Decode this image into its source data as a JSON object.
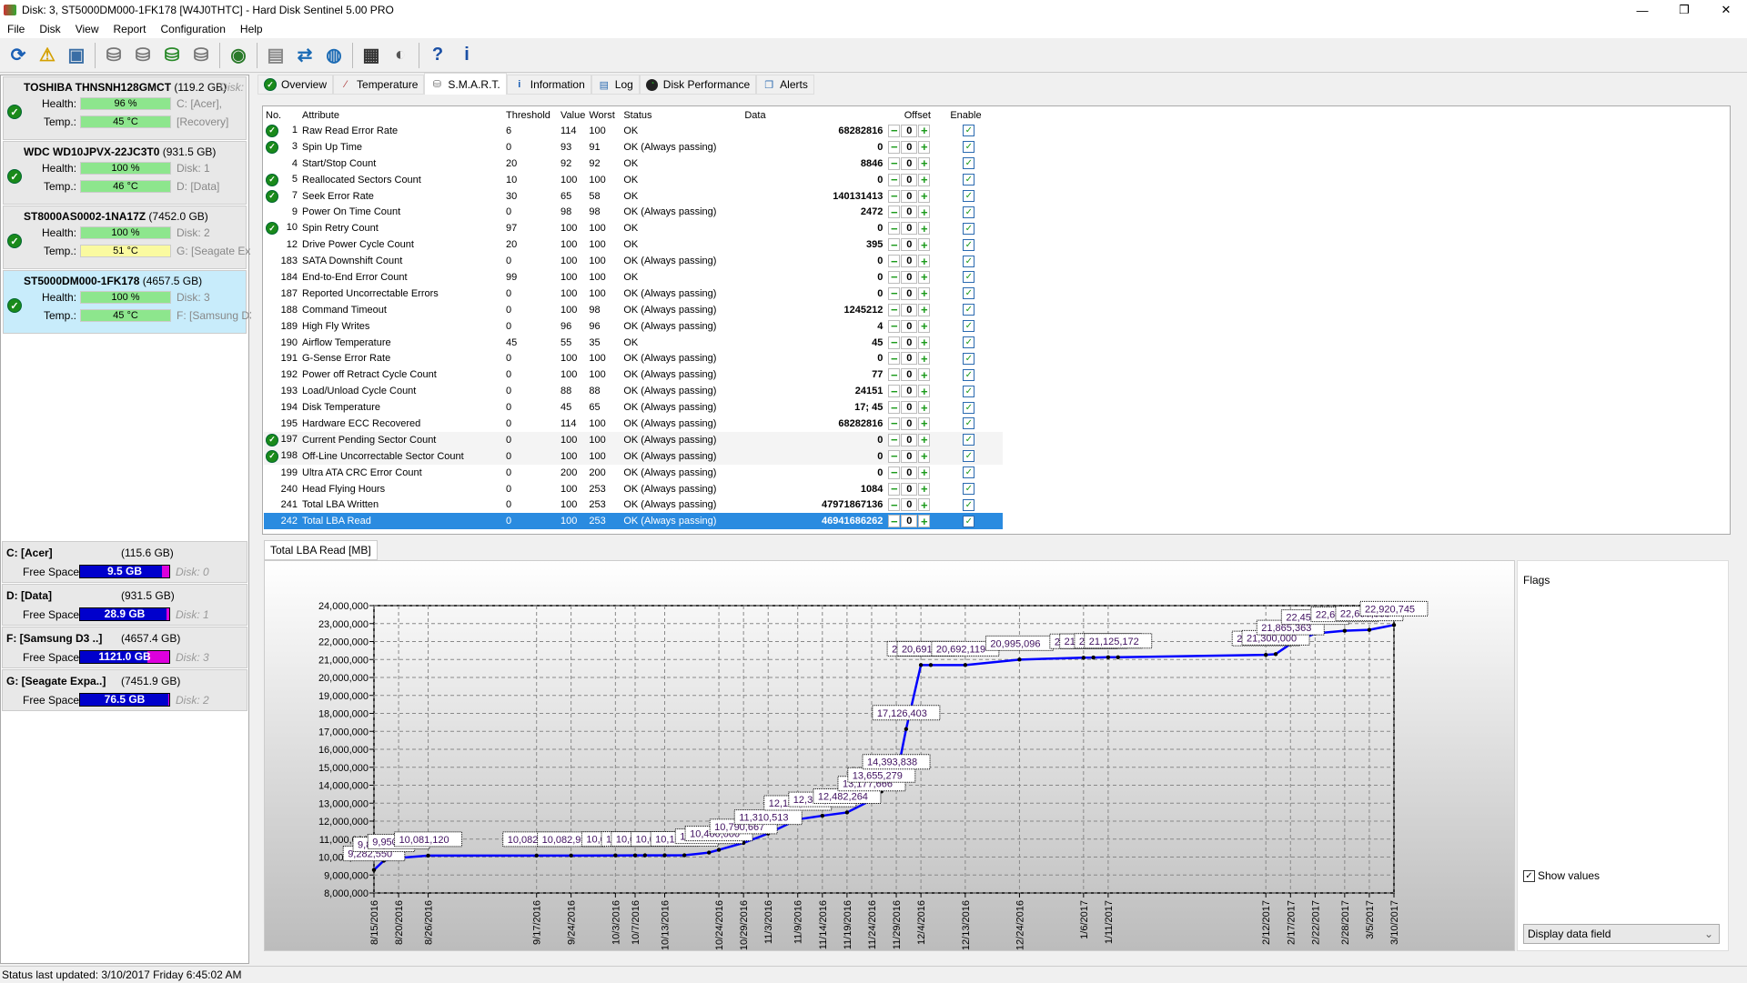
{
  "window": {
    "title": "Disk: 3, ST5000DM000-1FK178 [W4J0THTC]  -  Hard Disk Sentinel 5.00 PRO",
    "minimize": "—",
    "restore": "❐",
    "close": "✕"
  },
  "menu": [
    "File",
    "Disk",
    "View",
    "Report",
    "Configuration",
    "Help"
  ],
  "toolbar": [
    {
      "icon": "refresh-icon",
      "glyph": "⟳",
      "color": "#1a5fb4"
    },
    {
      "icon": "alert-refresh-icon",
      "glyph": "⚠",
      "color": "#d4a000"
    },
    {
      "icon": "disk-info-icon",
      "glyph": "▣",
      "color": "#3a6ea5"
    },
    {
      "sep": true
    },
    {
      "icon": "disk-tool-icon",
      "glyph": "⛁",
      "color": "#777"
    },
    {
      "icon": "disk-schedule-icon",
      "glyph": "⛁",
      "color": "#777"
    },
    {
      "icon": "disk-check-icon",
      "glyph": "⛁",
      "color": "#2a8a2a"
    },
    {
      "icon": "disk-search-icon",
      "glyph": "⛁",
      "color": "#777"
    },
    {
      "sep": true
    },
    {
      "icon": "globe-icon",
      "glyph": "◉",
      "color": "#2a7a2a"
    },
    {
      "sep": true
    },
    {
      "icon": "report-icon",
      "glyph": "▤",
      "color": "#888"
    },
    {
      "icon": "send-report-icon",
      "glyph": "⇄",
      "color": "#1a6ab4"
    },
    {
      "icon": "network-icon",
      "glyph": "◍",
      "color": "#1a6ab4"
    },
    {
      "sep": true
    },
    {
      "icon": "terminal-icon",
      "glyph": "▦",
      "color": "#333"
    },
    {
      "icon": "speaker-icon",
      "glyph": "◐",
      "color": "#555"
    },
    {
      "sep": true
    },
    {
      "icon": "help-icon",
      "glyph": "?",
      "color": "#1a4fa4"
    },
    {
      "icon": "info-icon",
      "glyph": "i",
      "color": "#1a4fa4"
    }
  ],
  "disks": [
    {
      "name": "TOSHIBA THNSNH128GMCT",
      "size": "(119.2 GB)",
      "disk": "Disk:",
      "health_label": "Health:",
      "health": "96 %",
      "temp_label": "Temp.:",
      "temp": "45 °C",
      "temp_color": "#8de68d",
      "info1": "C: [Acer],",
      "info2": "[Recovery]"
    },
    {
      "name": "WDC WD10JPVX-22JC3T0",
      "size": "(931.5 GB)",
      "disk": "",
      "health_label": "Health:",
      "health": "100 %",
      "temp_label": "Temp.:",
      "temp": "46 °C",
      "temp_color": "#8de68d",
      "info1": "Disk: 1",
      "info2": "D: [Data]"
    },
    {
      "name": "ST8000AS0002-1NA17Z",
      "size": "(7452.0 GB)",
      "disk": "",
      "health_label": "Health:",
      "health": "100 %",
      "temp_label": "Temp.:",
      "temp": "51 °C",
      "temp_color": "#fafaa0",
      "info1": "Disk: 2",
      "info2": "G: [Seagate Exp"
    },
    {
      "name": "ST5000DM000-1FK178",
      "size": "(4657.5 GB)",
      "disk": "",
      "health_label": "Health:",
      "health": "100 %",
      "temp_label": "Temp.:",
      "temp": "45 °C",
      "temp_color": "#8de68d",
      "info1": "Disk: 3",
      "info2": "F: [Samsung D3",
      "selected": true
    }
  ],
  "drives": [
    {
      "name": "C: [Acer]",
      "size": "(115.6 GB)",
      "free_label": "Free Space",
      "free": "9.5 GB",
      "free_fraction": 0.08,
      "disk": "Disk: 0"
    },
    {
      "name": "D: [Data]",
      "size": "(931.5 GB)",
      "free_label": "Free Space",
      "free": "28.9 GB",
      "free_fraction": 0.03,
      "disk": "Disk: 1"
    },
    {
      "name": "F: [Samsung D3 ..]",
      "size": "(4657.4 GB)",
      "free_label": "Free Space",
      "free": "1121.0 GB",
      "free_fraction": 0.24,
      "disk": "Disk: 3"
    },
    {
      "name": "G: [Seagate Expa..]",
      "size": "(7451.9 GB)",
      "free_label": "Free Space",
      "free": "76.5 GB",
      "free_fraction": 0.01,
      "disk": "Disk: 2"
    }
  ],
  "tabs": [
    {
      "label": "Overview",
      "icon": "check-icon"
    },
    {
      "label": "Temperature",
      "icon": "thermometer-icon"
    },
    {
      "label": "S.M.A.R.T.",
      "icon": "disk-icon",
      "active": true
    },
    {
      "label": "Information",
      "icon": "info-icon"
    },
    {
      "label": "Log",
      "icon": "log-icon"
    },
    {
      "label": "Disk Performance",
      "icon": "gauge-icon"
    },
    {
      "label": "Alerts",
      "icon": "alerts-icon"
    }
  ],
  "smart": {
    "columns": [
      "No.",
      "Attribute",
      "Threshold",
      "Value",
      "Worst",
      "Status",
      "Data",
      "Offset",
      "Enable"
    ],
    "rows": [
      {
        "ok": true,
        "no": "1",
        "attr": "Raw Read Error Rate",
        "th": "6",
        "val": "114",
        "worst": "100",
        "status": "OK",
        "data": "68282816",
        "offset": "0"
      },
      {
        "ok": true,
        "no": "3",
        "attr": "Spin Up Time",
        "th": "0",
        "val": "93",
        "worst": "91",
        "status": "OK (Always passing)",
        "data": "0",
        "offset": "0"
      },
      {
        "no": "4",
        "attr": "Start/Stop Count",
        "th": "20",
        "val": "92",
        "worst": "92",
        "status": "OK",
        "data": "8846",
        "offset": "0"
      },
      {
        "ok": true,
        "no": "5",
        "attr": "Reallocated Sectors Count",
        "th": "10",
        "val": "100",
        "worst": "100",
        "status": "OK",
        "data": "0",
        "offset": "0"
      },
      {
        "ok": true,
        "no": "7",
        "attr": "Seek Error Rate",
        "th": "30",
        "val": "65",
        "worst": "58",
        "status": "OK",
        "data": "140131413",
        "offset": "0"
      },
      {
        "no": "9",
        "attr": "Power On Time Count",
        "th": "0",
        "val": "98",
        "worst": "98",
        "status": "OK (Always passing)",
        "data": "2472",
        "offset": "0"
      },
      {
        "ok": true,
        "no": "10",
        "attr": "Spin Retry Count",
        "th": "97",
        "val": "100",
        "worst": "100",
        "status": "OK",
        "data": "0",
        "offset": "0"
      },
      {
        "no": "12",
        "attr": "Drive Power Cycle Count",
        "th": "20",
        "val": "100",
        "worst": "100",
        "status": "OK",
        "data": "395",
        "offset": "0"
      },
      {
        "no": "183",
        "attr": "SATA Downshift Count",
        "th": "0",
        "val": "100",
        "worst": "100",
        "status": "OK (Always passing)",
        "data": "0",
        "offset": "0"
      },
      {
        "no": "184",
        "attr": "End-to-End Error Count",
        "th": "99",
        "val": "100",
        "worst": "100",
        "status": "OK",
        "data": "0",
        "offset": "0"
      },
      {
        "no": "187",
        "attr": "Reported Uncorrectable Errors",
        "th": "0",
        "val": "100",
        "worst": "100",
        "status": "OK (Always passing)",
        "data": "0",
        "offset": "0"
      },
      {
        "no": "188",
        "attr": "Command Timeout",
        "th": "0",
        "val": "100",
        "worst": "98",
        "status": "OK (Always passing)",
        "data": "1245212",
        "offset": "0"
      },
      {
        "no": "189",
        "attr": "High Fly Writes",
        "th": "0",
        "val": "96",
        "worst": "96",
        "status": "OK (Always passing)",
        "data": "4",
        "offset": "0"
      },
      {
        "no": "190",
        "attr": "Airflow Temperature",
        "th": "45",
        "val": "55",
        "worst": "35",
        "status": "OK",
        "data": "45",
        "offset": "0"
      },
      {
        "no": "191",
        "attr": "G-Sense Error Rate",
        "th": "0",
        "val": "100",
        "worst": "100",
        "status": "OK (Always passing)",
        "data": "0",
        "offset": "0"
      },
      {
        "no": "192",
        "attr": "Power off Retract Cycle Count",
        "th": "0",
        "val": "100",
        "worst": "100",
        "status": "OK (Always passing)",
        "data": "77",
        "offset": "0"
      },
      {
        "no": "193",
        "attr": "Load/Unload Cycle Count",
        "th": "0",
        "val": "88",
        "worst": "88",
        "status": "OK (Always passing)",
        "data": "24151",
        "offset": "0"
      },
      {
        "no": "194",
        "attr": "Disk Temperature",
        "th": "0",
        "val": "45",
        "worst": "65",
        "status": "OK (Always passing)",
        "data": "17; 45",
        "offset": "0"
      },
      {
        "no": "195",
        "attr": "Hardware ECC Recovered",
        "th": "0",
        "val": "114",
        "worst": "100",
        "status": "OK (Always passing)",
        "data": "68282816",
        "offset": "0"
      },
      {
        "ok": true,
        "no": "197",
        "attr": "Current Pending Sector Count",
        "th": "0",
        "val": "100",
        "worst": "100",
        "status": "OK (Always passing)",
        "data": "0",
        "offset": "0"
      },
      {
        "ok": true,
        "no": "198",
        "attr": "Off-Line Uncorrectable Sector Count",
        "th": "0",
        "val": "100",
        "worst": "100",
        "status": "OK (Always passing)",
        "data": "0",
        "offset": "0"
      },
      {
        "no": "199",
        "attr": "Ultra ATA CRC Error Count",
        "th": "0",
        "val": "200",
        "worst": "200",
        "status": "OK (Always passing)",
        "data": "0",
        "offset": "0"
      },
      {
        "no": "240",
        "attr": "Head Flying Hours",
        "th": "0",
        "val": "100",
        "worst": "253",
        "status": "OK (Always passing)",
        "data": "1084",
        "offset": "0"
      },
      {
        "no": "241",
        "attr": "Total LBA Written",
        "th": "0",
        "val": "100",
        "worst": "253",
        "status": "OK (Always passing)",
        "data": "47971867136",
        "offset": "0"
      },
      {
        "no": "242",
        "attr": "Total LBA Read",
        "th": "0",
        "val": "100",
        "worst": "253",
        "status": "OK (Always passing)",
        "data": "46941686262",
        "offset": "0",
        "selected": true
      }
    ]
  },
  "chart_tab": "Total LBA Read [MB]",
  "chart_data": {
    "type": "line",
    "title": "",
    "xlabel": "",
    "ylabel": "",
    "ylim": [
      8000000,
      24000000
    ],
    "grid": true,
    "series_color": "#0000ff",
    "x_range": [
      "8/15/2016",
      "3/10/2017"
    ],
    "yticks": [
      "8,000,000",
      "9,000,000",
      "10,000,000",
      "11,000,000",
      "12,000,000",
      "13,000,000",
      "14,000,000",
      "15,000,000",
      "16,000,000",
      "17,000,000",
      "18,000,000",
      "19,000,000",
      "20,000,000",
      "21,000,000",
      "22,000,000",
      "23,000,000",
      "24,000,000"
    ],
    "xticks": [
      "8/15/2016",
      "8/20/2016",
      "8/26/2016",
      "9/17/2016",
      "9/24/2016",
      "10/3/2016",
      "10/7/2016",
      "10/13/2016",
      "10/24/2016",
      "10/29/2016",
      "11/3/2016",
      "11/9/2016",
      "11/14/2016",
      "11/19/2016",
      "11/24/2016",
      "11/29/2016",
      "12/4/2016",
      "12/13/2016",
      "12/24/2016",
      "1/6/2017",
      "1/11/2017",
      "2/12/2017",
      "2/17/2017",
      "2/22/2017",
      "2/28/2017",
      "3/5/2017",
      "3/10/2017"
    ],
    "points": [
      [
        "8/15/2016",
        9282550
      ],
      [
        "8/17/2016",
        9800000
      ],
      [
        "8/20/2016",
        9950000
      ],
      [
        "8/26/2016",
        10081120
      ],
      [
        "9/17/2016",
        10082500
      ],
      [
        "9/24/2016",
        10082950
      ],
      [
        "10/3/2016",
        10090000
      ],
      [
        "10/7/2016",
        10093000
      ],
      [
        "10/9/2016",
        10095000
      ],
      [
        "10/13/2016",
        10096900
      ],
      [
        "10/17/2016",
        10100000
      ],
      [
        "10/22/2016",
        10250000
      ],
      [
        "10/24/2016",
        10400000
      ],
      [
        "10/29/2016",
        10790667
      ],
      [
        "11/3/2016",
        11310513
      ],
      [
        "11/9/2016",
        12100000
      ],
      [
        "11/14/2016",
        12300000
      ],
      [
        "11/19/2016",
        12482264
      ],
      [
        "11/24/2016",
        13177666
      ],
      [
        "11/26/2016",
        13655279
      ],
      [
        "11/29/2016",
        14393838
      ],
      [
        "12/1/2016",
        17126403
      ],
      [
        "12/4/2016",
        20691000
      ],
      [
        "12/6/2016",
        20691500
      ],
      [
        "12/13/2016",
        20692119
      ],
      [
        "12/24/2016",
        20995096
      ],
      [
        "1/6/2017",
        21100000
      ],
      [
        "1/8/2017",
        21110000
      ],
      [
        "1/11/2017",
        21125172
      ],
      [
        "1/13/2017",
        21125172
      ],
      [
        "2/12/2017",
        21257476
      ],
      [
        "2/14/2017",
        21300000
      ],
      [
        "2/17/2017",
        21865363
      ],
      [
        "2/22/2017",
        22450000
      ],
      [
        "2/28/2017",
        22600000
      ],
      [
        "3/5/2017",
        22650000
      ],
      [
        "3/10/2017",
        22920745
      ]
    ]
  },
  "right_panel": {
    "flags": "Flags",
    "show_values": "Show values",
    "show_values_checked": true,
    "dropdown": "Display data field"
  },
  "status": "Status last updated: 3/10/2017 Friday 6:45:02 AM"
}
